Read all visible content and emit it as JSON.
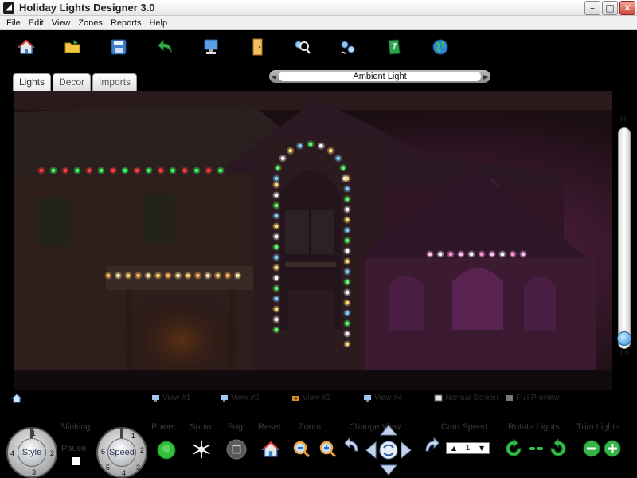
{
  "window": {
    "title": "Holiday Lights Designer 3.0",
    "app_icon": "app-logo-icon",
    "buttons": [
      "minimize",
      "maximize",
      "close"
    ]
  },
  "menu": [
    "File",
    "Edit",
    "View",
    "Zones",
    "Reports",
    "Help"
  ],
  "toolbar": {
    "buttons": [
      "home-icon",
      "open-folder-icon",
      "save-icon",
      "undo-icon",
      "computer-icon",
      "door-icon",
      "zoom-people-icon",
      "network-icon",
      "green-book-icon",
      "globe-icon"
    ]
  },
  "tabs": [
    "Lights",
    "Decor",
    "Imports"
  ],
  "light_selector": {
    "value": "Ambient Light"
  },
  "scroll_labels": {
    "top": "Hi",
    "bottom": "Lo"
  },
  "view_options": [
    {
      "label": "View #1",
      "icon": "monitor-icon"
    },
    {
      "label": "View #2",
      "icon": "monitor-icon"
    },
    {
      "label": "View #3",
      "icon": "camera-icon"
    },
    {
      "label": "View #4",
      "icon": "monitor-icon"
    },
    {
      "label": "Normal Screen",
      "icon": "screen-icon"
    },
    {
      "label": "Full Preview",
      "icon": "preview-icon"
    }
  ],
  "controls": {
    "blinking_label": "Blinking",
    "pause_label": "Pause",
    "style_label": "Style",
    "speed_label": "Speed",
    "power_label": "Power",
    "snow_label": "Snow",
    "fog_label": "Fog",
    "reset_label": "Reset",
    "zoom_label": "Zoom",
    "change_view_label": "Change View",
    "cam_speed_label": "Cam Speed",
    "cam_speed_value": "1",
    "rotate_lights_label": "Rotate Lights",
    "trim_lights_label": "Trim Lights",
    "style_dial_numbers": [
      "1",
      "2",
      "3",
      "4"
    ],
    "speed_dial_numbers": [
      "1",
      "2",
      "3",
      "4",
      "5",
      "6"
    ]
  }
}
